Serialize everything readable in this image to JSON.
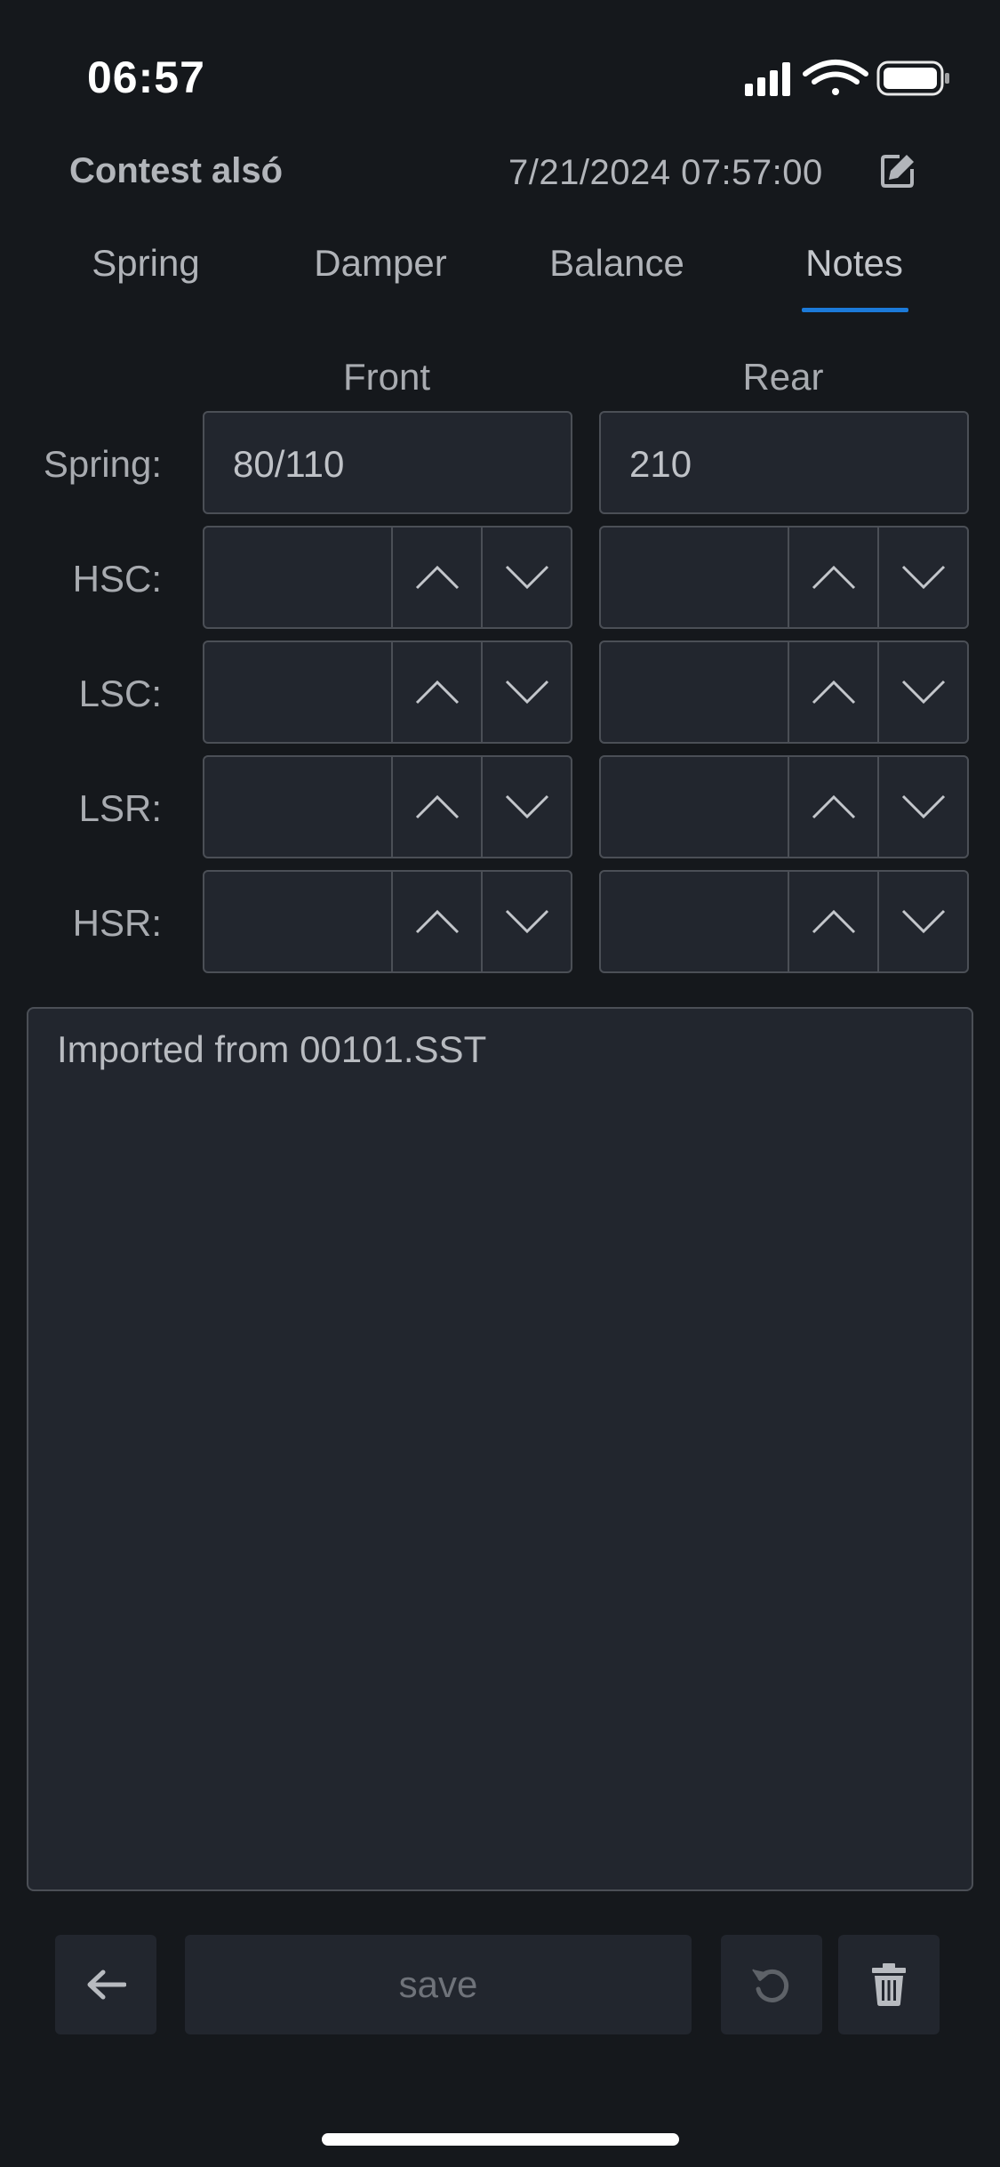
{
  "status_bar": {
    "time": "06:57"
  },
  "header": {
    "title": "Contest alsó",
    "datetime": "7/21/2024 07:57:00"
  },
  "tabs": [
    {
      "label": "Spring"
    },
    {
      "label": "Damper"
    },
    {
      "label": "Balance"
    },
    {
      "label": "Notes"
    }
  ],
  "active_tab": "Notes",
  "columns": {
    "front": "Front",
    "rear": "Rear"
  },
  "rows": {
    "spring": {
      "label": "Spring:",
      "front": "80/110",
      "rear": "210"
    },
    "hsc": {
      "label": "HSC:",
      "front": "",
      "rear": ""
    },
    "lsc": {
      "label": "LSC:",
      "front": "",
      "rear": ""
    },
    "lsr": {
      "label": "LSR:",
      "front": "",
      "rear": ""
    },
    "hsr": {
      "label": "HSR:",
      "front": "",
      "rear": ""
    }
  },
  "notes": {
    "text": "Imported from 00101.SST"
  },
  "toolbar": {
    "save_label": "save"
  },
  "colors": {
    "background": "#15181c",
    "field": "#22262e",
    "border": "#4b4f56",
    "accent": "#1c7ad9"
  },
  "icons": [
    "signal-icon",
    "wifi-icon",
    "battery-icon",
    "edit-icon",
    "chevron-up-icon",
    "chevron-down-icon",
    "arrow-left-icon",
    "undo-icon",
    "trash-icon"
  ]
}
